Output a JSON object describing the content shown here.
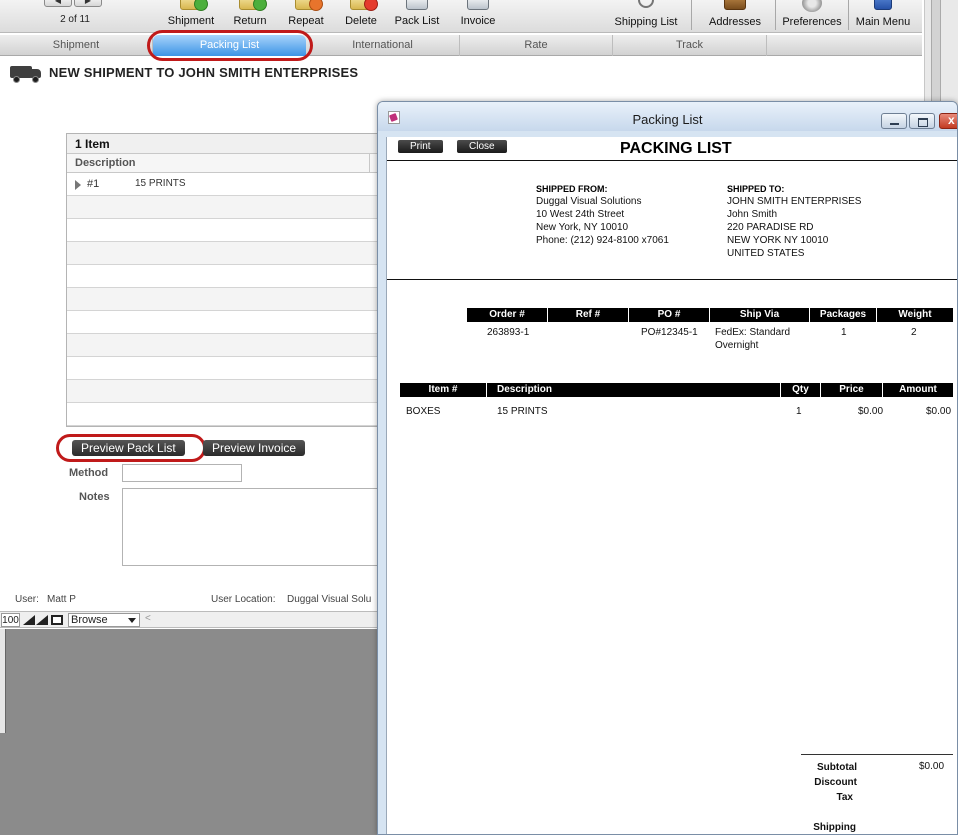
{
  "toolbar": {
    "record_counter": "2 of 11",
    "buttons": [
      {
        "label": "Shipment"
      },
      {
        "label": "Return"
      },
      {
        "label": "Repeat"
      },
      {
        "label": "Delete"
      },
      {
        "label": "Pack List"
      },
      {
        "label": "Invoice"
      },
      {
        "label": "Shipping List"
      },
      {
        "label": "Addresses"
      },
      {
        "label": "Preferences"
      },
      {
        "label": "Main Menu"
      }
    ]
  },
  "tabs": [
    {
      "label": "Shipment"
    },
    {
      "label": "Packing List",
      "active": true
    },
    {
      "label": "International"
    },
    {
      "label": "Rate"
    },
    {
      "label": "Track"
    }
  ],
  "shipment": {
    "title": "NEW SHIPMENT TO JOHN SMITH ENTERPRISES",
    "items_header": "1 Item",
    "description_col": "Description",
    "items": [
      {
        "num": "#1",
        "description": "15 PRINTS"
      }
    ],
    "preview_pack_list": "Preview Pack List",
    "preview_invoice": "Preview Invoice",
    "method_label": "Method",
    "notes_label": "Notes",
    "user_label": "User:",
    "user_value": "Matt P",
    "location_label": "User Location:",
    "location_value": "Duggal Visual Solu"
  },
  "bottom_bar": {
    "zoom": "100",
    "mode": "Browse"
  },
  "packing_window": {
    "title": "Packing List",
    "print_button": "Print",
    "close_button": "Close",
    "heading": "PACKING LIST",
    "shipped_from": {
      "label": "SHIPPED FROM:",
      "lines": [
        "Duggal Visual Solutions",
        "10 West 24th Street",
        "New York, NY  10010",
        "Phone: (212) 924-8100 x7061"
      ]
    },
    "shipped_to": {
      "label": "SHIPPED TO:",
      "lines": [
        "JOHN SMITH ENTERPRISES",
        "John Smith",
        "220 PARADISE RD",
        "NEW YORK NY 10010",
        "UNITED STATES"
      ]
    },
    "order_headers": [
      "Order #",
      "Ref #",
      "PO #",
      "Ship Via",
      "Packages",
      "Weight"
    ],
    "order_row": {
      "order": "263893-1",
      "ref": "",
      "po": "PO#12345-1",
      "ship_via_1": "FedEx: Standard",
      "ship_via_2": "Overnight",
      "packages": "1",
      "weight": "2"
    },
    "item_headers": [
      "Item #",
      "Description",
      "Qty",
      "Price",
      "Amount"
    ],
    "item_row": {
      "item": "BOXES",
      "description": "15 PRINTS",
      "qty": "1",
      "price": "$0.00",
      "amount": "$0.00"
    },
    "totals": {
      "subtotal_label": "Subtotal",
      "subtotal_value": "$0.00",
      "discount_label": "Discount",
      "tax_label": "Tax",
      "shipping_label": "Shipping"
    }
  },
  "colors": {
    "tab_active": "#3d94e6",
    "highlight_ring": "#c01a1a",
    "header_black": "#000000"
  }
}
